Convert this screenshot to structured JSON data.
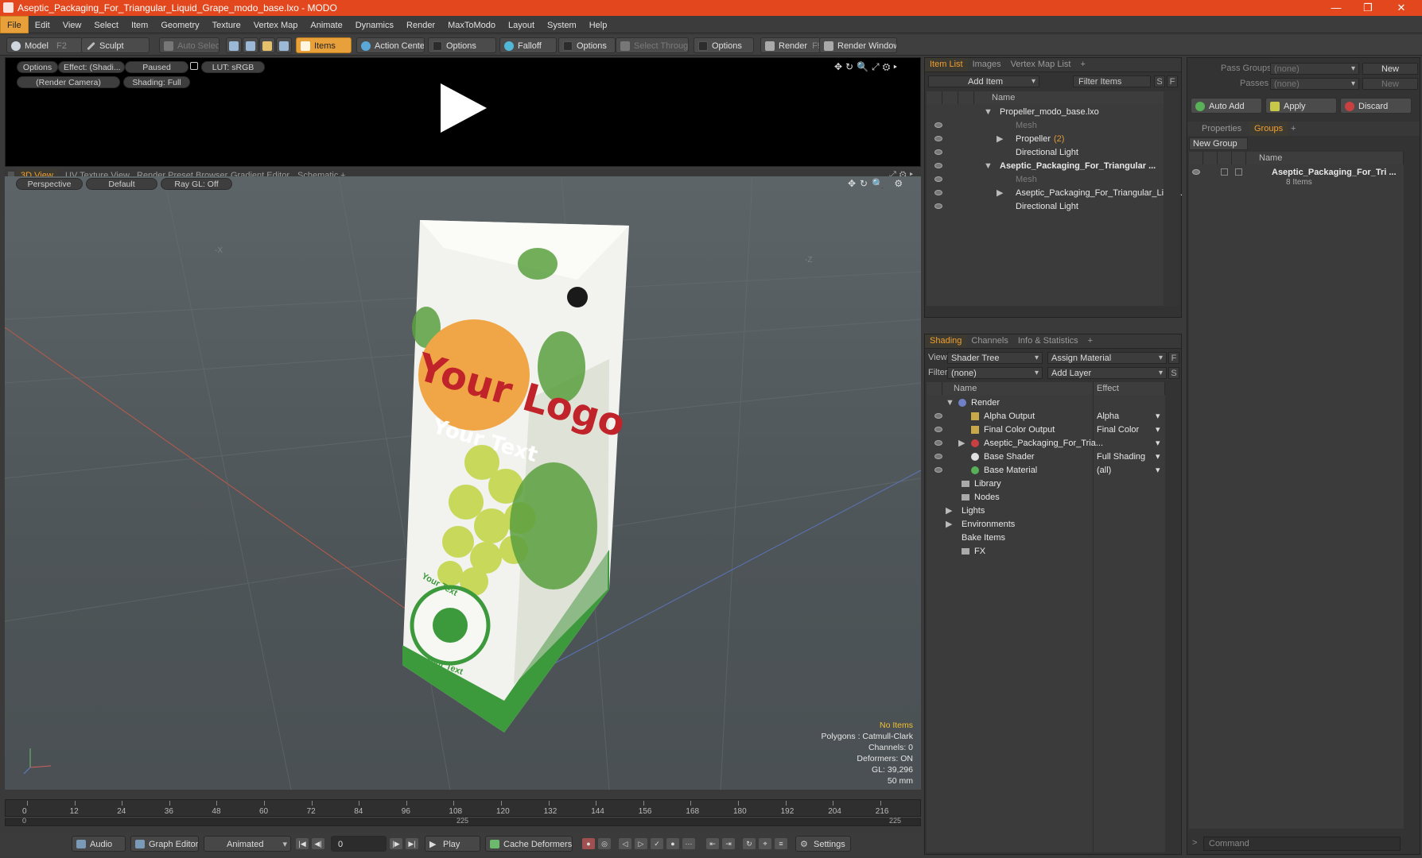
{
  "window": {
    "title": "Aseptic_Packaging_For_Triangular_Liquid_Grape_modo_base.lxo - MODO"
  },
  "menu": [
    "File",
    "Edit",
    "View",
    "Select",
    "Item",
    "Geometry",
    "Texture",
    "Vertex Map",
    "Animate",
    "Dynamics",
    "Render",
    "MaxToModo",
    "Layout",
    "System",
    "Help"
  ],
  "toolbar": {
    "model": "Model",
    "model_hotkey": "F2",
    "sculpt": "Sculpt",
    "auto_select": "Auto Select",
    "items": "Items",
    "action_center": "Action Center",
    "options1": "Options",
    "falloff": "Falloff",
    "options2": "Options",
    "select_through": "Select Through",
    "options3": "Options",
    "render": "Render",
    "render_hotkey": "F9",
    "render_window": "Render Window"
  },
  "preview": {
    "options": "Options",
    "effect": "Effect: (Shadi...",
    "paused": "Paused",
    "lut": "LUT: sRGB",
    "camera": "(Render Camera)",
    "shading": "Shading: Full"
  },
  "viewport_tabs": [
    "3D View",
    "UV Texture View",
    "Render Preset Browser",
    "Gradient Editor",
    "Schematic",
    "+"
  ],
  "viewport": {
    "mode": "Perspective",
    "style": "Default",
    "raygl": "Ray GL: Off",
    "axis_x": "-X",
    "axis_z": "-Z",
    "status": [
      "No Items",
      "Polygons : Catmull-Clark",
      "Channels: 0",
      "Deformers: ON",
      "GL: 39,296",
      "50 mm"
    ],
    "package": {
      "logo": "Your Logo",
      "text": "Your Text",
      "stamp_top": "Your Text",
      "stamp_bottom": "Your Text"
    }
  },
  "timeline": {
    "ticks": [
      "0",
      "12",
      "24",
      "36",
      "48",
      "60",
      "72",
      "84",
      "96",
      "108",
      "120",
      "132",
      "144",
      "156",
      "168",
      "180",
      "192",
      "204",
      "216"
    ],
    "sub_left": "0",
    "sub_mid": "225",
    "sub_right": "225"
  },
  "bottombar": {
    "audio": "Audio",
    "graph_editor": "Graph Editor",
    "animated": "Animated",
    "frame": "0",
    "play": "Play",
    "cache_deformers": "Cache Deformers",
    "settings": "Settings"
  },
  "item_list": {
    "tabs": [
      "Item List",
      "Images",
      "Vertex Map List",
      "+"
    ],
    "add_item": "Add Item",
    "filter_items": "Filter Items",
    "s": "S",
    "f": "F",
    "col_name": "Name",
    "rows": [
      "Propeller_modo_base.lxo",
      "Mesh",
      "Propeller",
      "(2)",
      "Directional Light",
      "Aseptic_Packaging_For_Triangular ...",
      "Mesh",
      "Aseptic_Packaging_For_Triangular_Liqui...",
      "Directional Light"
    ]
  },
  "shading": {
    "tabs": [
      "Shading",
      "Channels",
      "Info & Statistics",
      "+"
    ],
    "view_label": "View",
    "view_value": "Shader Tree",
    "assign_material": "Assign Material",
    "f": "F",
    "filter_label": "Filter",
    "filter_value": "(none)",
    "add_layer": "Add Layer",
    "s": "S",
    "col_name": "Name",
    "col_effect": "Effect",
    "rows": [
      {
        "name": "Render",
        "effect": ""
      },
      {
        "name": "Alpha Output",
        "effect": "Alpha"
      },
      {
        "name": "Final Color Output",
        "effect": "Final Color"
      },
      {
        "name": "Aseptic_Packaging_For_Tria...",
        "effect": ""
      },
      {
        "name": "Base Shader",
        "effect": "Full Shading"
      },
      {
        "name": "Base Material",
        "effect": "(all)"
      },
      {
        "name": "Library",
        "effect": ""
      },
      {
        "name": "Nodes",
        "effect": ""
      },
      {
        "name": "Lights",
        "effect": ""
      },
      {
        "name": "Environments",
        "effect": ""
      },
      {
        "name": "Bake Items",
        "effect": ""
      },
      {
        "name": "FX",
        "effect": ""
      }
    ]
  },
  "right_panel": {
    "pass_groups": "Pass Groups",
    "pass_value": "(none)",
    "new": "New",
    "passes": "Passes",
    "passes_value": "(none)",
    "new2": "New",
    "auto_add": "Auto Add",
    "apply": "Apply",
    "discard": "Discard",
    "tabs": [
      "Properties",
      "Groups",
      "+"
    ],
    "new_group": "New Group",
    "col_name": "Name",
    "group_name": "Aseptic_Packaging_For_Tri ...",
    "group_items": "8 Items",
    "command": "Command"
  },
  "colors": {
    "accent": "#f0a030",
    "title_bar": "#e2471d",
    "panel": "#333333",
    "viewport": "#555c60"
  }
}
